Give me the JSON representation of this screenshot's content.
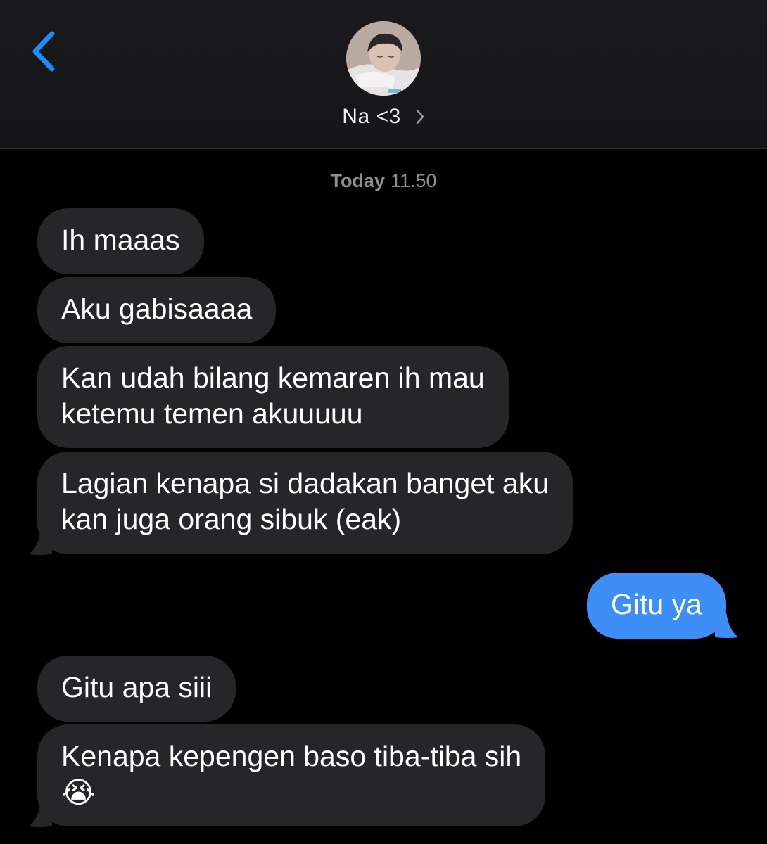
{
  "header": {
    "back_icon": "chevron-left-icon",
    "contact_name": "Na <3",
    "contact_chevron_icon": "chevron-right-icon",
    "avatar_icon": "contact-avatar-photo"
  },
  "thread": {
    "timestamp_day": "Today",
    "timestamp_time": "11.50",
    "messages": [
      {
        "direction": "received",
        "text": "Ih maaas"
      },
      {
        "direction": "received",
        "text": "Aku gabisaaaa"
      },
      {
        "direction": "received",
        "line1": "Kan udah bilang kemaren ih mau",
        "line2": "ketemu temen akuuuuu"
      },
      {
        "direction": "received",
        "line1": "Lagian kenapa si dadakan banget aku",
        "line2": "kan juga orang sibuk (eak)"
      },
      {
        "direction": "sent",
        "text": "Gitu ya"
      },
      {
        "direction": "received",
        "text": "Gitu apa siii"
      },
      {
        "direction": "received",
        "line1": "Kenapa kepengen baso tiba-tiba sih",
        "emoji": "😭"
      }
    ]
  },
  "colors": {
    "received_bubble": "#262629",
    "sent_bubble": "#3d8ef7",
    "accent": "#1e8cff",
    "timestamp": "#8d8d92"
  }
}
